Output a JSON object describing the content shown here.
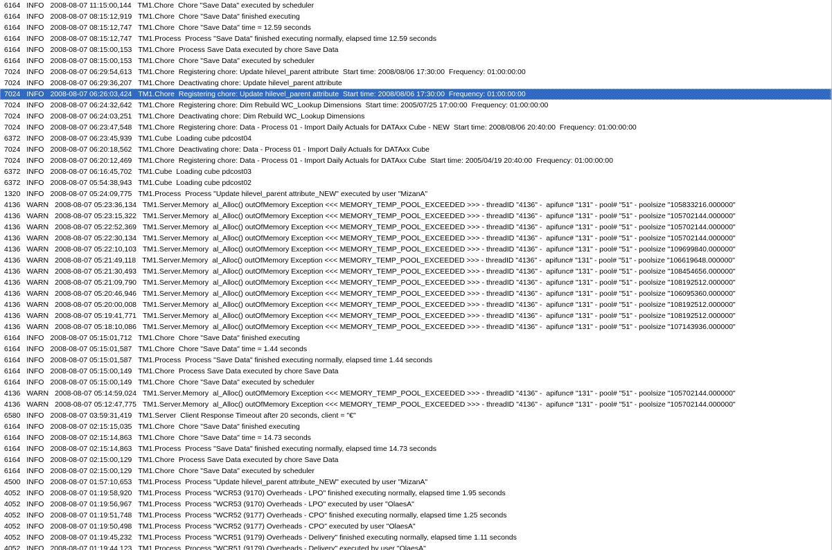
{
  "log": {
    "selected_index": 8,
    "rows": [
      {
        "thread": "6164",
        "level": "INFO",
        "ts": "2008-08-07 11:15:00,144",
        "logger": "TM1.Chore",
        "msg": "Chore \"Save Data\" executed by scheduler"
      },
      {
        "thread": "6164",
        "level": "INFO",
        "ts": "2008-08-07 08:15:12,919",
        "logger": "TM1.Chore",
        "msg": "Chore \"Save Data\" finished executing"
      },
      {
        "thread": "6164",
        "level": "INFO",
        "ts": "2008-08-07 08:15:12,747",
        "logger": "TM1.Chore",
        "msg": "Chore \"Save Data\" time = 12.59 seconds"
      },
      {
        "thread": "6164",
        "level": "INFO",
        "ts": "2008-08-07 08:15:12,747",
        "logger": "TM1.Process",
        "msg": "Process \"Save Data\" finished executing normally, elapsed time 12.59 seconds"
      },
      {
        "thread": "6164",
        "level": "INFO",
        "ts": "2008-08-07 08:15:00,153",
        "logger": "TM1.Chore",
        "msg": "Process Save Data executed by chore Save Data"
      },
      {
        "thread": "6164",
        "level": "INFO",
        "ts": "2008-08-07 08:15:00,153",
        "logger": "TM1.Chore",
        "msg": "Chore \"Save Data\" executed by scheduler"
      },
      {
        "thread": "7024",
        "level": "INFO",
        "ts": "2008-08-07 06:29:54,613",
        "logger": "TM1.Chore",
        "msg": "Registering chore: Update hilevel_parent attribute  Start time: 2008/08/06 17:30:00  Frequency: 01:00:00:00"
      },
      {
        "thread": "7024",
        "level": "INFO",
        "ts": "2008-08-07 06:29:36,207",
        "logger": "TM1.Chore",
        "msg": "Deactivating chore: Update hilevel_parent attribute"
      },
      {
        "thread": "7024",
        "level": "INFO",
        "ts": "2008-08-07 06:26:03,424",
        "logger": "TM1.Chore",
        "msg": "Registering chore: Update hilevel_parent attribute  Start time: 2008/08/06 17:30:00  Frequency: 01:00:00:00"
      },
      {
        "thread": "7024",
        "level": "INFO",
        "ts": "2008-08-07 06:24:32,642",
        "logger": "TM1.Chore",
        "msg": "Registering chore: Dim Rebuild WC_Lookup Dimensions  Start time: 2005/07/25 17:00:00  Frequency: 01:00:00:00"
      },
      {
        "thread": "7024",
        "level": "INFO",
        "ts": "2008-08-07 06:24:03,251",
        "logger": "TM1.Chore",
        "msg": "Deactivating chore: Dim Rebuild WC_Lookup Dimensions"
      },
      {
        "thread": "7024",
        "level": "INFO",
        "ts": "2008-08-07 06:23:47,548",
        "logger": "TM1.Chore",
        "msg": "Registering chore: Data - Process 01 - Import Daily Actuals for DATAxx Cube - NEW  Start time: 2008/08/06 20:40:00  Frequency: 01:00:00:00"
      },
      {
        "thread": "6372",
        "level": "INFO",
        "ts": "2008-08-07 06:23:45,939",
        "logger": "TM1.Cube",
        "msg": "Loading cube pdcost04"
      },
      {
        "thread": "7024",
        "level": "INFO",
        "ts": "2008-08-07 06:20:18,562",
        "logger": "TM1.Chore",
        "msg": "Deactivating chore: Data - Process 01 - Import Daily Actuals for DATAxx Cube"
      },
      {
        "thread": "7024",
        "level": "INFO",
        "ts": "2008-08-07 06:20:12,469",
        "logger": "TM1.Chore",
        "msg": "Registering chore: Data - Process 01 - Import Daily Actuals for DATAxx Cube  Start time: 2005/04/19 20:40:00  Frequency: 01:00:00:00"
      },
      {
        "thread": "6372",
        "level": "INFO",
        "ts": "2008-08-07 06:16:45,702",
        "logger": "TM1.Cube",
        "msg": "Loading cube pdcost03"
      },
      {
        "thread": "6372",
        "level": "INFO",
        "ts": "2008-08-07 05:54:38,943",
        "logger": "TM1.Cube",
        "msg": "Loading cube pdcost02"
      },
      {
        "thread": "1320",
        "level": "INFO",
        "ts": "2008-08-07 05:24:09,775",
        "logger": "TM1.Process",
        "msg": "Process \"Update hilevel_parent attribute_NEW\" executed by user \"MizanA\""
      },
      {
        "thread": "4136",
        "level": "WARN",
        "ts": "2008-08-07 05:23:36,134",
        "logger": "TM1.Server.Memory",
        "msg": "al_Alloc() outOfMemory Exception <<< MEMORY_TEMP_POOL_EXCEEDED >>> - threadID \"4136\" -  apifunc# \"131\" - pool# \"51\" - poolsize \"105833216.000000\""
      },
      {
        "thread": "4136",
        "level": "WARN",
        "ts": "2008-08-07 05:23:15,322",
        "logger": "TM1.Server.Memory",
        "msg": "al_Alloc() outOfMemory Exception <<< MEMORY_TEMP_POOL_EXCEEDED >>> - threadID \"4136\" -  apifunc# \"131\" - pool# \"51\" - poolsize \"105702144.000000\""
      },
      {
        "thread": "4136",
        "level": "WARN",
        "ts": "2008-08-07 05:22:52,369",
        "logger": "TM1.Server.Memory",
        "msg": "al_Alloc() outOfMemory Exception <<< MEMORY_TEMP_POOL_EXCEEDED >>> - threadID \"4136\" -  apifunc# \"131\" - pool# \"51\" - poolsize \"105702144.000000\""
      },
      {
        "thread": "4136",
        "level": "WARN",
        "ts": "2008-08-07 05:22:30,134",
        "logger": "TM1.Server.Memory",
        "msg": "al_Alloc() outOfMemory Exception <<< MEMORY_TEMP_POOL_EXCEEDED >>> - threadID \"4136\" -  apifunc# \"131\" - pool# \"51\" - poolsize \"105702144.000000\""
      },
      {
        "thread": "4136",
        "level": "WARN",
        "ts": "2008-08-07 05:22:10,103",
        "logger": "TM1.Server.Memory",
        "msg": "al_Alloc() outOfMemory Exception <<< MEMORY_TEMP_POOL_EXCEEDED >>> - threadID \"4136\" -  apifunc# \"131\" - pool# \"51\" - poolsize \"109699840.000000\""
      },
      {
        "thread": "4136",
        "level": "WARN",
        "ts": "2008-08-07 05:21:49,118",
        "logger": "TM1.Server.Memory",
        "msg": "al_Alloc() outOfMemory Exception <<< MEMORY_TEMP_POOL_EXCEEDED >>> - threadID \"4136\" -  apifunc# \"131\" - pool# \"51\" - poolsize \"106619648.000000\""
      },
      {
        "thread": "4136",
        "level": "WARN",
        "ts": "2008-08-07 05:21:30,493",
        "logger": "TM1.Server.Memory",
        "msg": "al_Alloc() outOfMemory Exception <<< MEMORY_TEMP_POOL_EXCEEDED >>> - threadID \"4136\" -  apifunc# \"131\" - pool# \"51\" - poolsize \"108454656.000000\""
      },
      {
        "thread": "4136",
        "level": "WARN",
        "ts": "2008-08-07 05:21:09,790",
        "logger": "TM1.Server.Memory",
        "msg": "al_Alloc() outOfMemory Exception <<< MEMORY_TEMP_POOL_EXCEEDED >>> - threadID \"4136\" -  apifunc# \"131\" - pool# \"51\" - poolsize \"108192512.000000\""
      },
      {
        "thread": "4136",
        "level": "WARN",
        "ts": "2008-08-07 05:20:46,946",
        "logger": "TM1.Server.Memory",
        "msg": "al_Alloc() outOfMemory Exception <<< MEMORY_TEMP_POOL_EXCEEDED >>> - threadID \"4136\" -  apifunc# \"131\" - pool# \"51\" - poolsize \"106095360.000000\""
      },
      {
        "thread": "4136",
        "level": "WARN",
        "ts": "2008-08-07 05:20:00,008",
        "logger": "TM1.Server.Memory",
        "msg": "al_Alloc() outOfMemory Exception <<< MEMORY_TEMP_POOL_EXCEEDED >>> - threadID \"4136\" -  apifunc# \"131\" - pool# \"51\" - poolsize \"108192512.000000\""
      },
      {
        "thread": "4136",
        "level": "WARN",
        "ts": "2008-08-07 05:19:41,771",
        "logger": "TM1.Server.Memory",
        "msg": "al_Alloc() outOfMemory Exception <<< MEMORY_TEMP_POOL_EXCEEDED >>> - threadID \"4136\" -  apifunc# \"131\" - pool# \"51\" - poolsize \"108192512.000000\""
      },
      {
        "thread": "4136",
        "level": "WARN",
        "ts": "2008-08-07 05:18:10,086",
        "logger": "TM1.Server.Memory",
        "msg": "al_Alloc() outOfMemory Exception <<< MEMORY_TEMP_POOL_EXCEEDED >>> - threadID \"4136\" -  apifunc# \"131\" - pool# \"51\" - poolsize \"107143936.000000\""
      },
      {
        "thread": "6164",
        "level": "INFO",
        "ts": "2008-08-07 05:15:01,712",
        "logger": "TM1.Chore",
        "msg": "Chore \"Save Data\" finished executing"
      },
      {
        "thread": "6164",
        "level": "INFO",
        "ts": "2008-08-07 05:15:01,587",
        "logger": "TM1.Chore",
        "msg": "Chore \"Save Data\" time = 1.44 seconds"
      },
      {
        "thread": "6164",
        "level": "INFO",
        "ts": "2008-08-07 05:15:01,587",
        "logger": "TM1.Process",
        "msg": "Process \"Save Data\" finished executing normally, elapsed time 1.44 seconds"
      },
      {
        "thread": "6164",
        "level": "INFO",
        "ts": "2008-08-07 05:15:00,149",
        "logger": "TM1.Chore",
        "msg": "Process Save Data executed by chore Save Data"
      },
      {
        "thread": "6164",
        "level": "INFO",
        "ts": "2008-08-07 05:15:00,149",
        "logger": "TM1.Chore",
        "msg": "Chore \"Save Data\" executed by scheduler"
      },
      {
        "thread": "4136",
        "level": "WARN",
        "ts": "2008-08-07 05:14:59,024",
        "logger": "TM1.Server.Memory",
        "msg": "al_Alloc() outOfMemory Exception <<< MEMORY_TEMP_POOL_EXCEEDED >>> - threadID \"4136\" -  apifunc# \"131\" - pool# \"51\" - poolsize \"105702144.000000\""
      },
      {
        "thread": "4136",
        "level": "WARN",
        "ts": "2008-08-07 05:12:47,775",
        "logger": "TM1.Server.Memory",
        "msg": "al_Alloc() outOfMemory Exception <<< MEMORY_TEMP_POOL_EXCEEDED >>> - threadID \"4136\" -  apifunc# \"131\" - pool# \"51\" - poolsize \"105702144.000000\""
      },
      {
        "thread": "6580",
        "level": "INFO",
        "ts": "2008-08-07 03:59:31,419",
        "logger": "TM1.Server",
        "msg": "Client Response Timeout after 20 seconds, client = \"€\""
      },
      {
        "thread": "6164",
        "level": "INFO",
        "ts": "2008-08-07 02:15:15,035",
        "logger": "TM1.Chore",
        "msg": "Chore \"Save Data\" finished executing"
      },
      {
        "thread": "6164",
        "level": "INFO",
        "ts": "2008-08-07 02:15:14,863",
        "logger": "TM1.Chore",
        "msg": "Chore \"Save Data\" time = 14.73 seconds"
      },
      {
        "thread": "6164",
        "level": "INFO",
        "ts": "2008-08-07 02:15:14,863",
        "logger": "TM1.Process",
        "msg": "Process \"Save Data\" finished executing normally, elapsed time 14.73 seconds"
      },
      {
        "thread": "6164",
        "level": "INFO",
        "ts": "2008-08-07 02:15:00,129",
        "logger": "TM1.Chore",
        "msg": "Process Save Data executed by chore Save Data"
      },
      {
        "thread": "6164",
        "level": "INFO",
        "ts": "2008-08-07 02:15:00,129",
        "logger": "TM1.Chore",
        "msg": "Chore \"Save Data\" executed by scheduler"
      },
      {
        "thread": "4500",
        "level": "INFO",
        "ts": "2008-08-07 01:57:10,653",
        "logger": "TM1.Process",
        "msg": "Process \"Update hilevel_parent attribute_NEW\" executed by user \"MizanA\""
      },
      {
        "thread": "4052",
        "level": "INFO",
        "ts": "2008-08-07 01:19:58,920",
        "logger": "TM1.Process",
        "msg": "Process \"WCR53 (9170) Overheads - LPO\" finished executing normally, elapsed time 1.95 seconds"
      },
      {
        "thread": "4052",
        "level": "INFO",
        "ts": "2008-08-07 01:19:56,967",
        "logger": "TM1.Process",
        "msg": "Process \"WCR53 (9170) Overheads - LPO\" executed by user \"OlaesA\""
      },
      {
        "thread": "4052",
        "level": "INFO",
        "ts": "2008-08-07 01:19:51,748",
        "logger": "TM1.Process",
        "msg": "Process \"WCR52 (9177) Overheads - CPO\" finished executing normally, elapsed time 1.25 seconds"
      },
      {
        "thread": "4052",
        "level": "INFO",
        "ts": "2008-08-07 01:19:50,498",
        "logger": "TM1.Process",
        "msg": "Process \"WCR52 (9177) Overheads - CPO\" executed by user \"OlaesA\""
      },
      {
        "thread": "4052",
        "level": "INFO",
        "ts": "2008-08-07 01:19:45,232",
        "logger": "TM1.Process",
        "msg": "Process \"WCR51 (9179) Overheads - Delivery\" finished executing normally, elapsed time 1.11 seconds"
      },
      {
        "thread": "4052",
        "level": "INFO",
        "ts": "2008-08-07 01:19:44,123",
        "logger": "TM1.Process",
        "msg": "Process \"WCR51 (9179) Overheads - Delivery\" executed by user \"OlaesA\""
      }
    ]
  },
  "colors": {
    "selection_bg": "#316ac5",
    "selection_text": "#ffffff",
    "text": "#000000",
    "background": "#ffffff"
  }
}
